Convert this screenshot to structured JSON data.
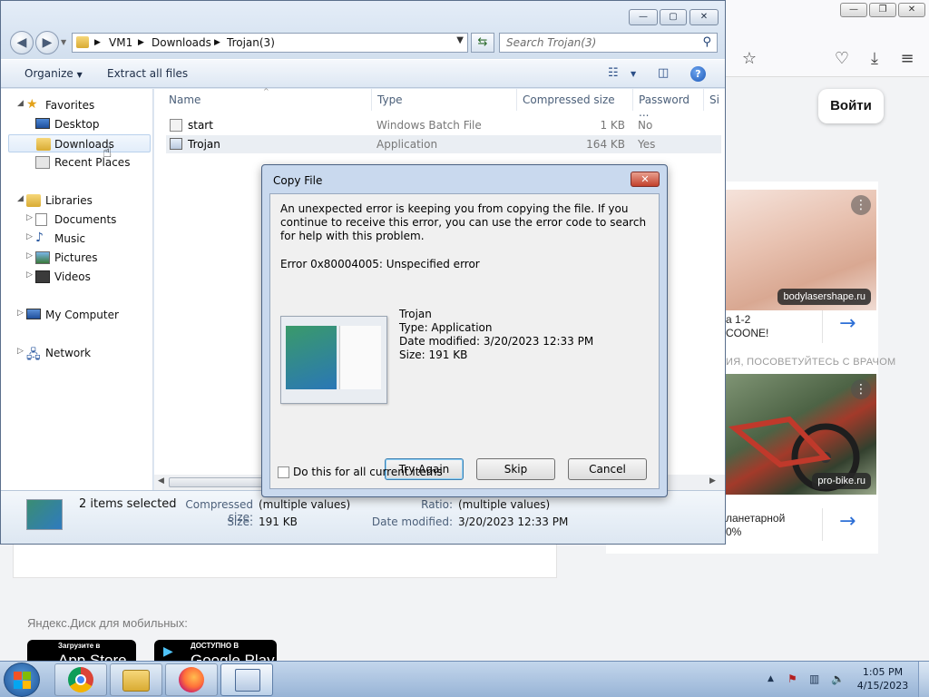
{
  "browser": {
    "login_label": "Войти",
    "ads": [
      {
        "badge": "bodylasershape.ru",
        "text_line1": "а 1-2",
        "text_line2": "COONE!"
      },
      {
        "badge": "pro-bike.ru",
        "text_line1": "ланетарной",
        "text_line2": "0%"
      }
    ],
    "disclaimer": "ИЯ, ПОСОВЕТУЙТЕСЬ С ВРАЧОМ",
    "mobile_label": "Яндекс.Диск для мобильных:",
    "app_store_small": "Загрузите в",
    "app_store_big": "App Store",
    "google_play_small": "ДОСТУПНО В",
    "google_play_big": "Google Play"
  },
  "explorer": {
    "breadcrumb": [
      "VM1",
      "Downloads",
      "Trojan(3)"
    ],
    "search_placeholder": "Search Trojan(3)",
    "toolbar": {
      "organize": "Organize",
      "extract_all": "Extract all files"
    },
    "nav": {
      "favorites": "Favorites",
      "desktop": "Desktop",
      "downloads": "Downloads",
      "recent": "Recent Places",
      "libraries": "Libraries",
      "documents": "Documents",
      "music": "Music",
      "pictures": "Pictures",
      "videos": "Videos",
      "computer": "My Computer",
      "network": "Network"
    },
    "columns": {
      "name": "Name",
      "type": "Type",
      "compressed": "Compressed size",
      "password": "Password ...",
      "size": "Si"
    },
    "files": [
      {
        "name": "start",
        "type": "Windows Batch File",
        "compressed": "1 KB",
        "password": "No"
      },
      {
        "name": "Trojan",
        "type": "Application",
        "compressed": "164 KB",
        "password": "Yes"
      }
    ],
    "details": {
      "selected": "2 items selected",
      "compressed_label": "Compressed size:",
      "compressed_value": "(multiple values)",
      "ratio_label": "Ratio:",
      "ratio_value": "(multiple values)",
      "size_label": "Size:",
      "size_value": "191 KB",
      "modified_label": "Date modified:",
      "modified_value": "3/20/2023 12:33 PM"
    }
  },
  "dialog": {
    "title": "Copy File",
    "message": "An unexpected error is keeping you from copying the file. If you continue to receive this error, you can use the error code to search for help with this problem.",
    "error": "Error 0x80004005: Unspecified error",
    "file_name": "Trojan",
    "file_type": "Type: Application",
    "file_modified": "Date modified: 3/20/2023 12:33 PM",
    "file_size": "Size: 191 KB",
    "try_again": "Try Again",
    "skip": "Skip",
    "cancel": "Cancel",
    "checkbox_label": "Do this for all current items"
  },
  "taskbar": {
    "time": "1:05 PM",
    "date": "4/15/2023"
  }
}
